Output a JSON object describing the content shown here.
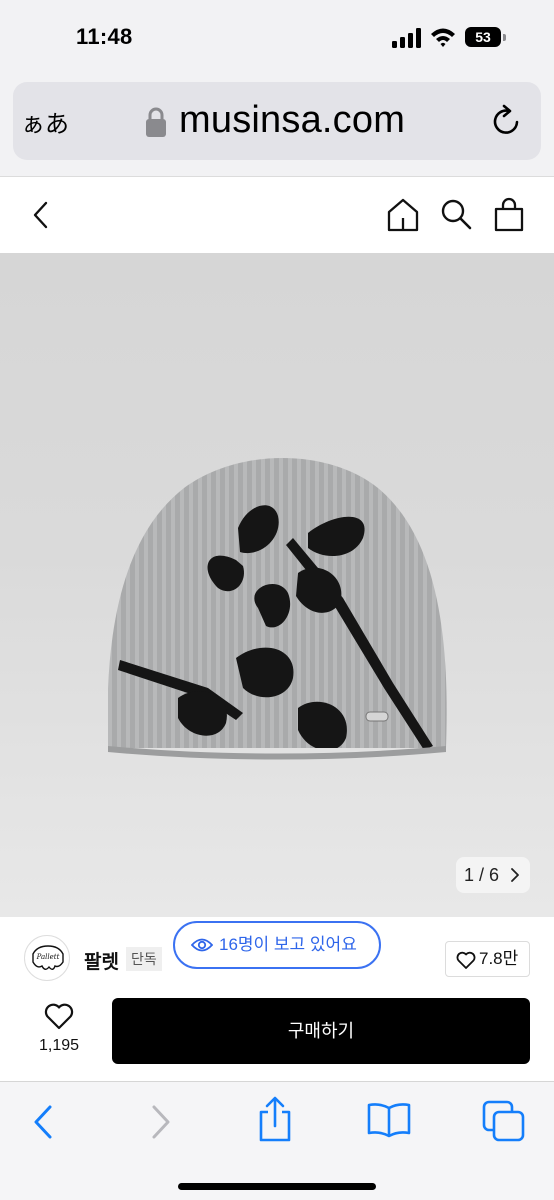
{
  "status_bar": {
    "time": "11:48",
    "battery": "53",
    "icons": [
      "signal-icon",
      "wifi-icon",
      "battery-icon"
    ]
  },
  "browser": {
    "text_size_label": "ぁあ",
    "url": "musinsa.com",
    "toolbar_icons": [
      "back-icon",
      "forward-icon",
      "share-icon",
      "bookmarks-icon",
      "tabs-icon"
    ]
  },
  "site_header": {
    "icons": [
      "back-icon",
      "home-icon",
      "search-icon",
      "bag-icon"
    ]
  },
  "product": {
    "image_counter": "1 / 6",
    "image_background": "#d9d9d9"
  },
  "brand": {
    "logo_text": "Pallett",
    "name": "팔렛",
    "badge": "단독",
    "viewers_text": "16명이 보고 있어요",
    "like_count": "7.8만"
  },
  "actions": {
    "wishlist_count": "1,195",
    "buy_label": "구매하기"
  },
  "colors": {
    "accent_blue": "#3b72f2",
    "buy_button": "#000000",
    "browser_tint": "#147efb"
  }
}
